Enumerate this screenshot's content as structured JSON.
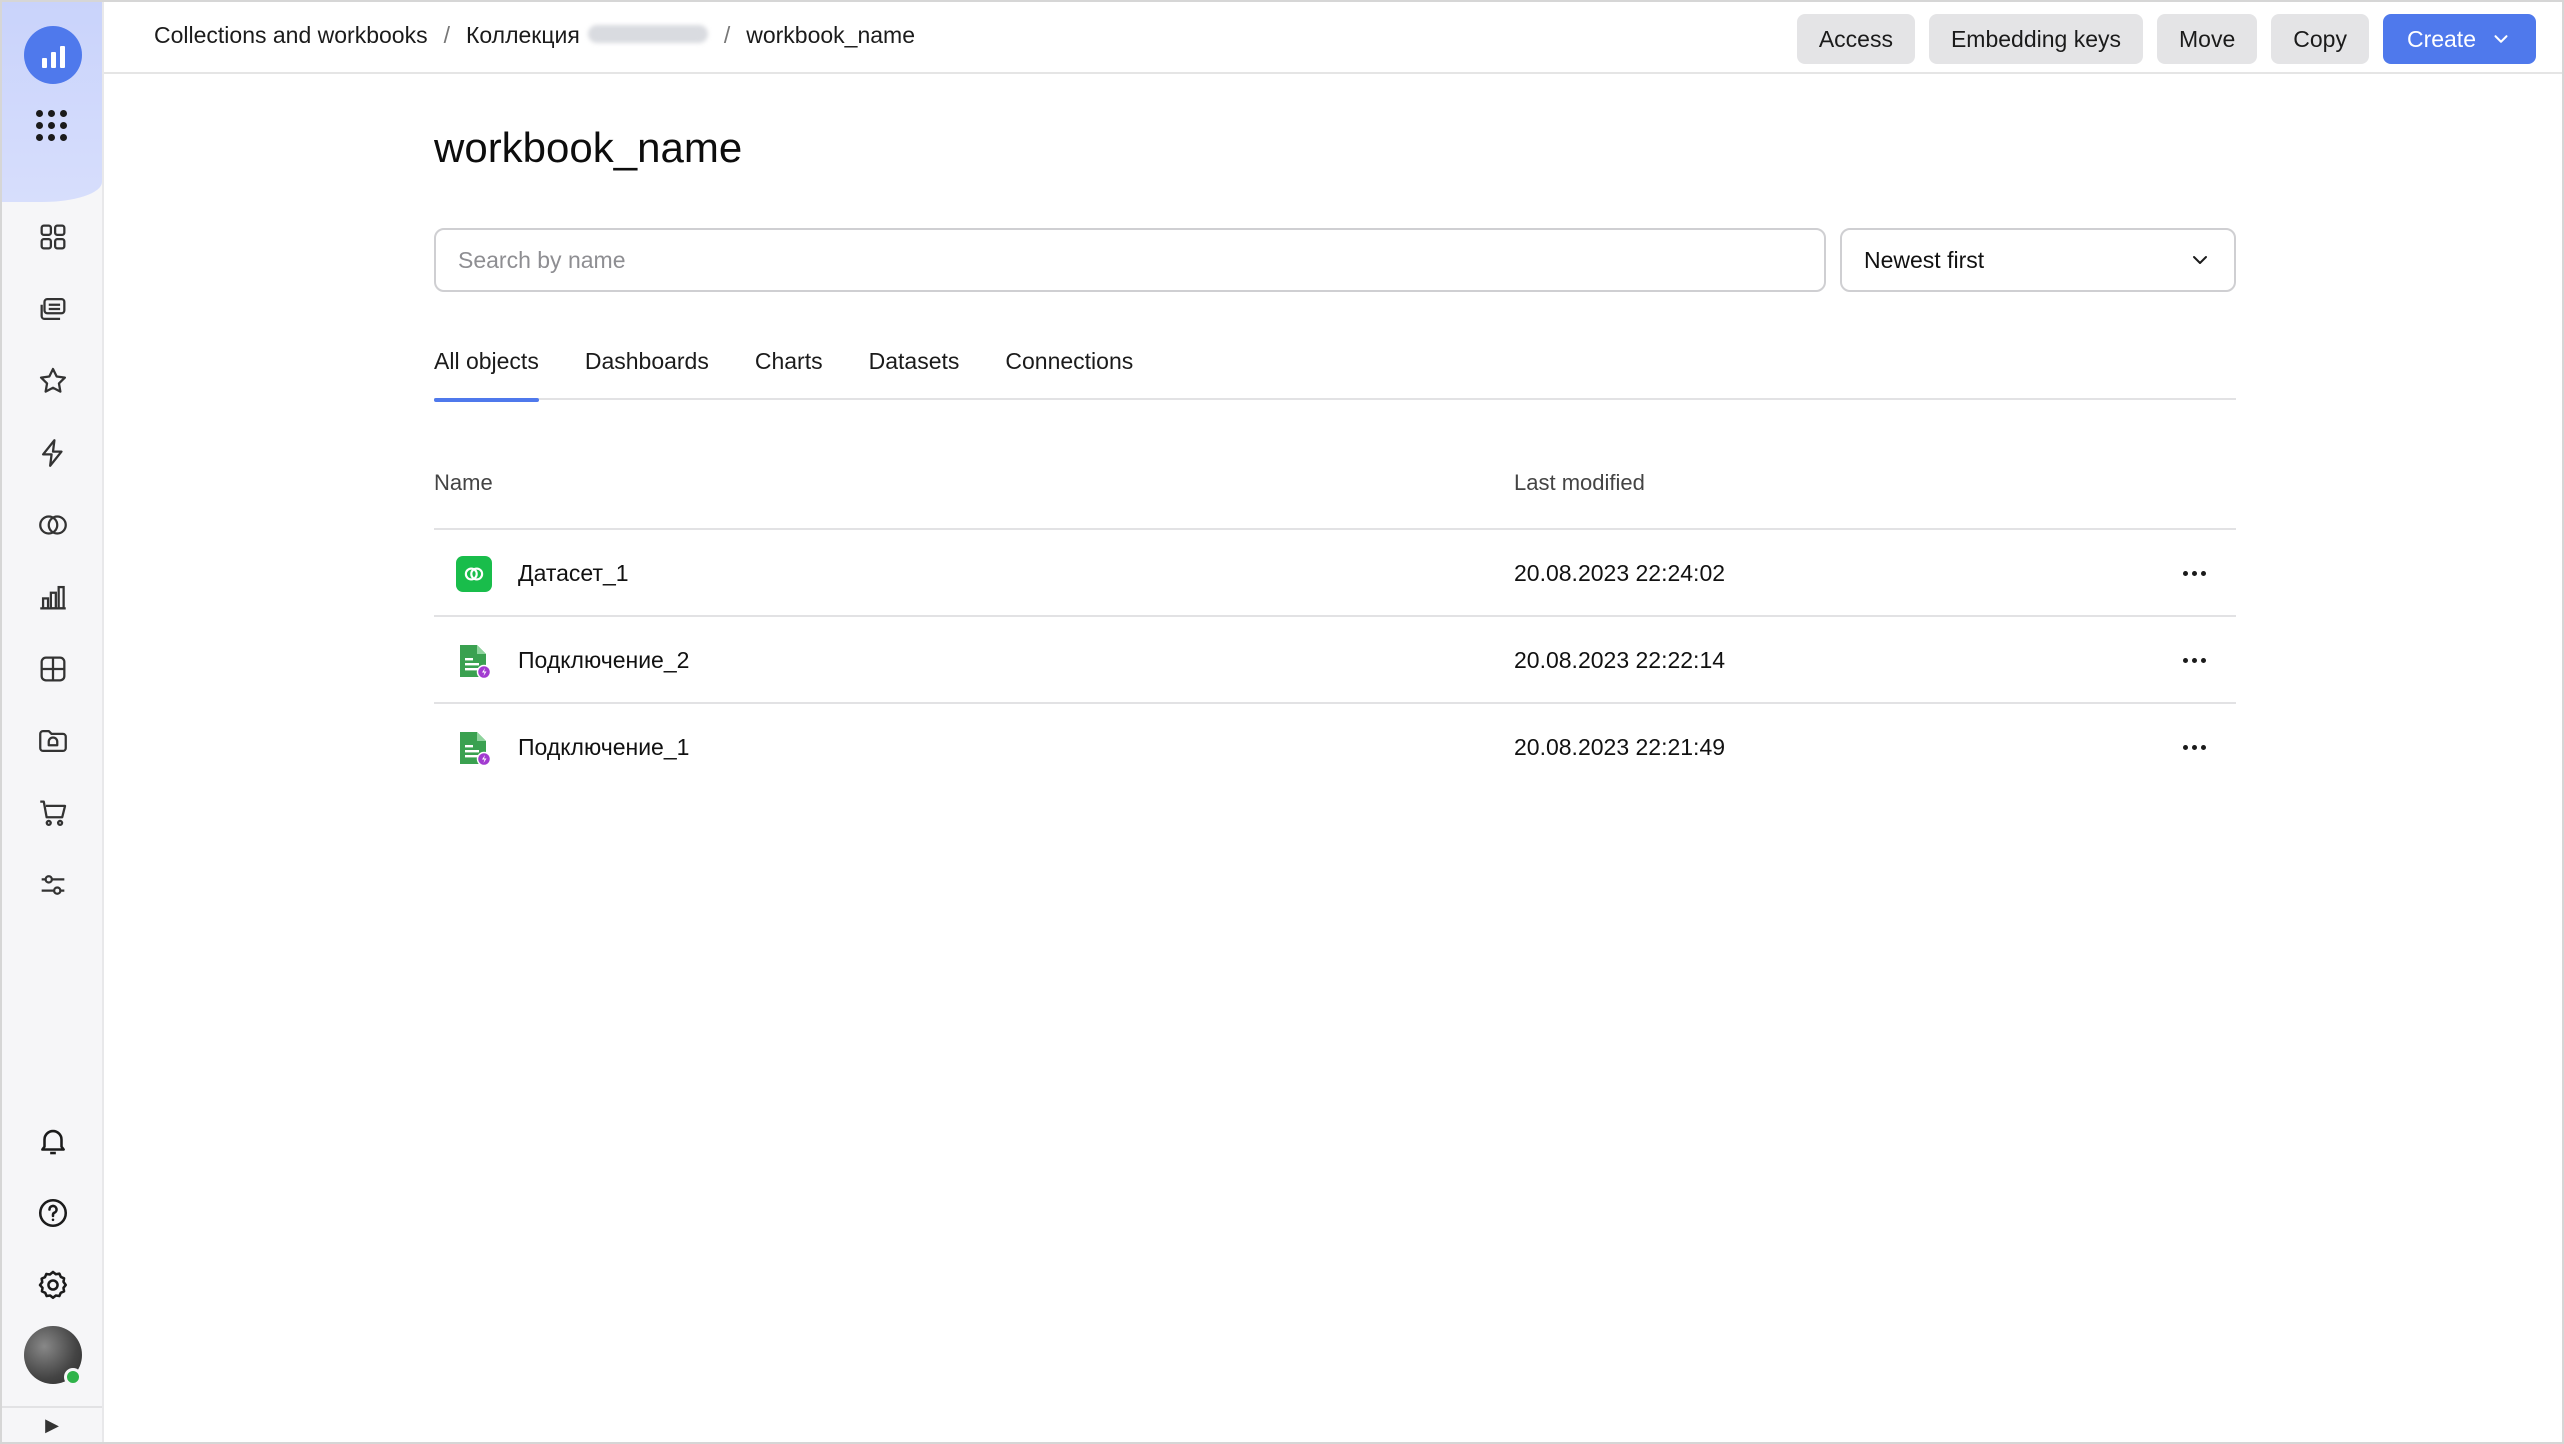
{
  "header": {
    "breadcrumbs": [
      "Collections and workbooks",
      "Коллекция",
      "workbook_name"
    ],
    "actions": {
      "access": "Access",
      "embedding_keys": "Embedding keys",
      "move": "Move",
      "copy": "Copy",
      "create": "Create"
    }
  },
  "page": {
    "title": "workbook_name",
    "search_placeholder": "Search by name",
    "sort_value": "Newest first"
  },
  "tabs": [
    "All objects",
    "Dashboards",
    "Charts",
    "Datasets",
    "Connections"
  ],
  "active_tab": "All objects",
  "table": {
    "columns": {
      "name": "Name",
      "modified": "Last modified"
    },
    "rows": [
      {
        "name": "Датасет_1",
        "modified": "20.08.2023 22:24:02",
        "type": "dataset-icon"
      },
      {
        "name": "Подключение_2",
        "modified": "20.08.2023 22:22:14",
        "type": "connection-icon"
      },
      {
        "name": "Подключение_1",
        "modified": "20.08.2023 22:21:49",
        "type": "connection-icon"
      }
    ]
  },
  "sidebar": {
    "icons": [
      "dashboards-icon",
      "workbooks-icon",
      "favorites-icon",
      "connections-icon",
      "datasets-icon",
      "charts-icon",
      "editor-icon",
      "collections-icon",
      "marketplace-icon",
      "settings-sliders-icon"
    ],
    "bottom_icons": [
      "notifications-icon",
      "help-icon",
      "settings-icon"
    ]
  },
  "colors": {
    "accent": "#4f79ec",
    "dataset_green": "#19bd4b",
    "connection_green": "#3aa150",
    "connection_badge": "#a23bd0"
  }
}
